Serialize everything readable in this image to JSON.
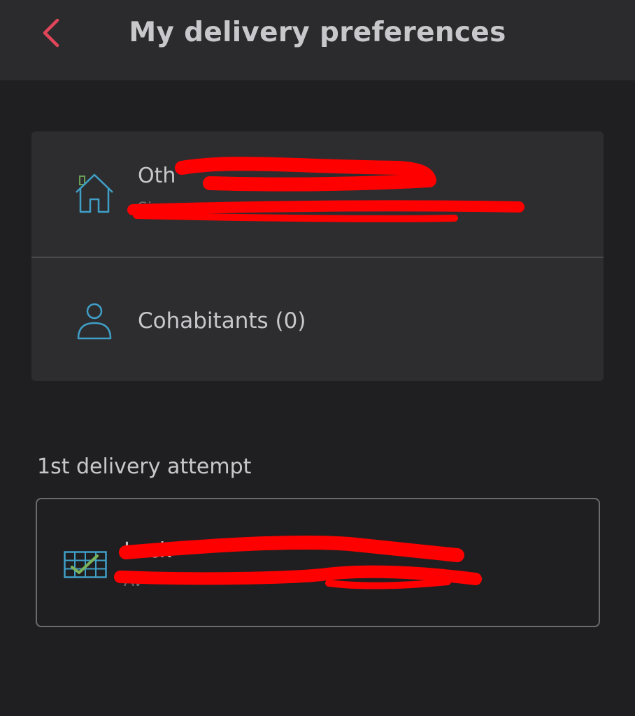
{
  "header": {
    "title": "My delivery preferences",
    "back_icon": "chevron-left-icon",
    "accent_color": "#e0465a"
  },
  "addresses": {
    "home": {
      "icon": "house-icon",
      "title": "Oth",
      "subtitle": "Si"
    },
    "cohabitants": {
      "icon": "person-icon",
      "label": "Cohabitants (0)"
    }
  },
  "delivery": {
    "section_title": "1st delivery attempt",
    "locker": {
      "icon": "parcel-locker-icon",
      "title": "Lock",
      "subtitle": "Av"
    }
  },
  "icon_color": "#3f9fc7",
  "redaction_color": "#ff0000"
}
